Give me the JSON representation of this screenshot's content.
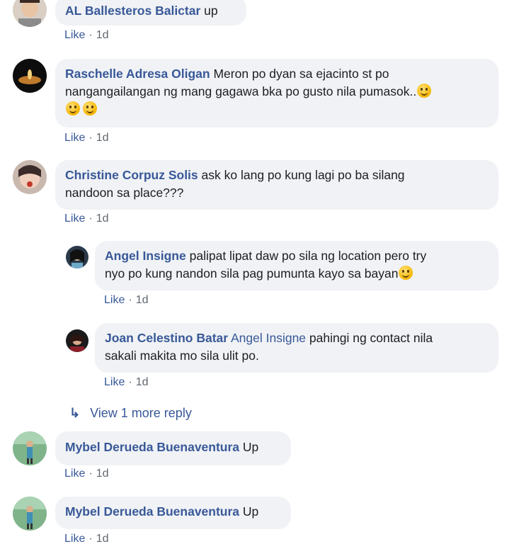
{
  "comments": [
    {
      "author": "AL Ballesteros Balictar",
      "text": "up",
      "like": "Like",
      "sep": "·",
      "age": "1d"
    },
    {
      "author": "Raschelle Adresa Oligan",
      "text1": "Meron po dyan sa ejacinto st po",
      "text2": "nangangailangan ng mang gagawa bka po gusto nila pumasok..",
      "like": "Like",
      "sep": "·",
      "age": "1d"
    },
    {
      "author": "Christine Corpuz Solis",
      "text1": "ask ko lang po kung lagi po ba silang",
      "text2": "nandoon sa place???",
      "like": "Like",
      "sep": "·",
      "age": "1d"
    },
    {
      "author": "Angel Insigne",
      "text1": "palipat lipat daw po sila ng location pero try",
      "text2": "nyo po kung nandon sila pag pumunta kayo sa bayan",
      "like": "Like",
      "sep": "·",
      "age": "1d"
    },
    {
      "author": "Joan Celestino Batar",
      "mention": "Angel Insigne",
      "text1": "pahingi ng contact nila",
      "text2": "sakali makita mo sila ulit po.",
      "like": "Like",
      "sep": "·",
      "age": "1d"
    },
    {
      "author": "Mybel Derueda Buenaventura",
      "text": "Up",
      "like": "Like",
      "sep": "·",
      "age": "1d"
    },
    {
      "author": "Mybel Derueda Buenaventura",
      "text": "Up",
      "like": "Like",
      "sep": "·",
      "age": "1d"
    }
  ],
  "view_more_reply": "View 1 more reply",
  "colors": {
    "name": "#385898",
    "bubble": "#f0f2f5",
    "meta": "#606770"
  }
}
